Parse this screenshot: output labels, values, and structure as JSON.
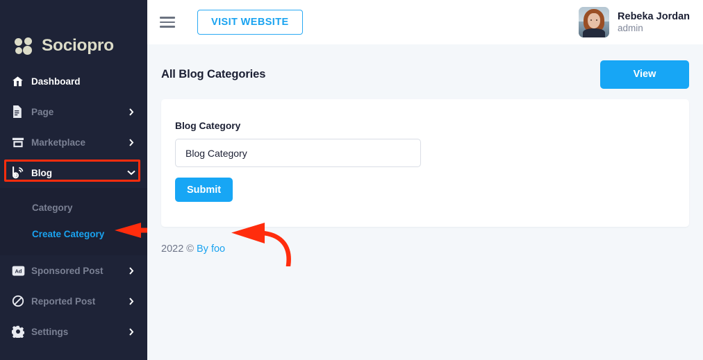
{
  "brand": {
    "name": "Sociopro",
    "logo_icon": "four-circles-logo-icon",
    "logo_color": "#dcdcc8"
  },
  "colors": {
    "sidebar_bg": "#1e2337",
    "submenu_bg": "#1c2033",
    "content_bg": "#f4f7fa",
    "accent_blue": "#17a6f5",
    "link_blue": "#1aa3f0",
    "annotation_red": "#ff2d0d",
    "muted_text": "#7b8194"
  },
  "sidebar": {
    "items": [
      {
        "label": "Dashboard",
        "icon": "home-icon",
        "active": true,
        "has_chevron": false,
        "chevron": ""
      },
      {
        "label": "Page",
        "icon": "document-icon",
        "active": false,
        "has_chevron": true,
        "chevron": "right"
      },
      {
        "label": "Marketplace",
        "icon": "store-icon",
        "active": false,
        "has_chevron": true,
        "chevron": "right"
      },
      {
        "label": "Blog",
        "icon": "blog-rss-icon",
        "active": true,
        "has_chevron": true,
        "chevron": "down"
      },
      {
        "label": "Sponsored Post",
        "icon": "ad-badge-icon",
        "active": false,
        "has_chevron": true,
        "chevron": "right"
      },
      {
        "label": "Reported Post",
        "icon": "prohibited-icon",
        "active": false,
        "has_chevron": true,
        "chevron": "right"
      },
      {
        "label": "Settings",
        "icon": "gear-icon",
        "active": false,
        "has_chevron": true,
        "chevron": "right"
      }
    ],
    "blog_submenu": [
      {
        "label": "Category",
        "current": false
      },
      {
        "label": "Create Category",
        "current": true
      }
    ]
  },
  "topbar": {
    "menu_icon": "hamburger-icon",
    "visit_website_label": "VISIT WEBSITE",
    "user": {
      "name": "Rebeka Jordan",
      "role": "admin",
      "avatar_icon": "user-photo-avatar"
    }
  },
  "main": {
    "page_title": "All Blog Categories",
    "view_label": "View",
    "form": {
      "field_label": "Blog Category",
      "input_value": "",
      "input_placeholder": "Blog Category",
      "submit_label": "Submit"
    }
  },
  "footer": {
    "copyright": "2022 ©",
    "link_label": "By foo"
  },
  "annotations": [
    {
      "type": "rectangle-highlight",
      "target": "sidebar-item-blog",
      "color": "#ff2d0d"
    },
    {
      "type": "straight-arrow-left",
      "target": "submenu-create-category",
      "color": "#ff2d0d"
    },
    {
      "type": "curved-arrow-left",
      "target": "submit-button",
      "color": "#ff2d0d"
    }
  ]
}
